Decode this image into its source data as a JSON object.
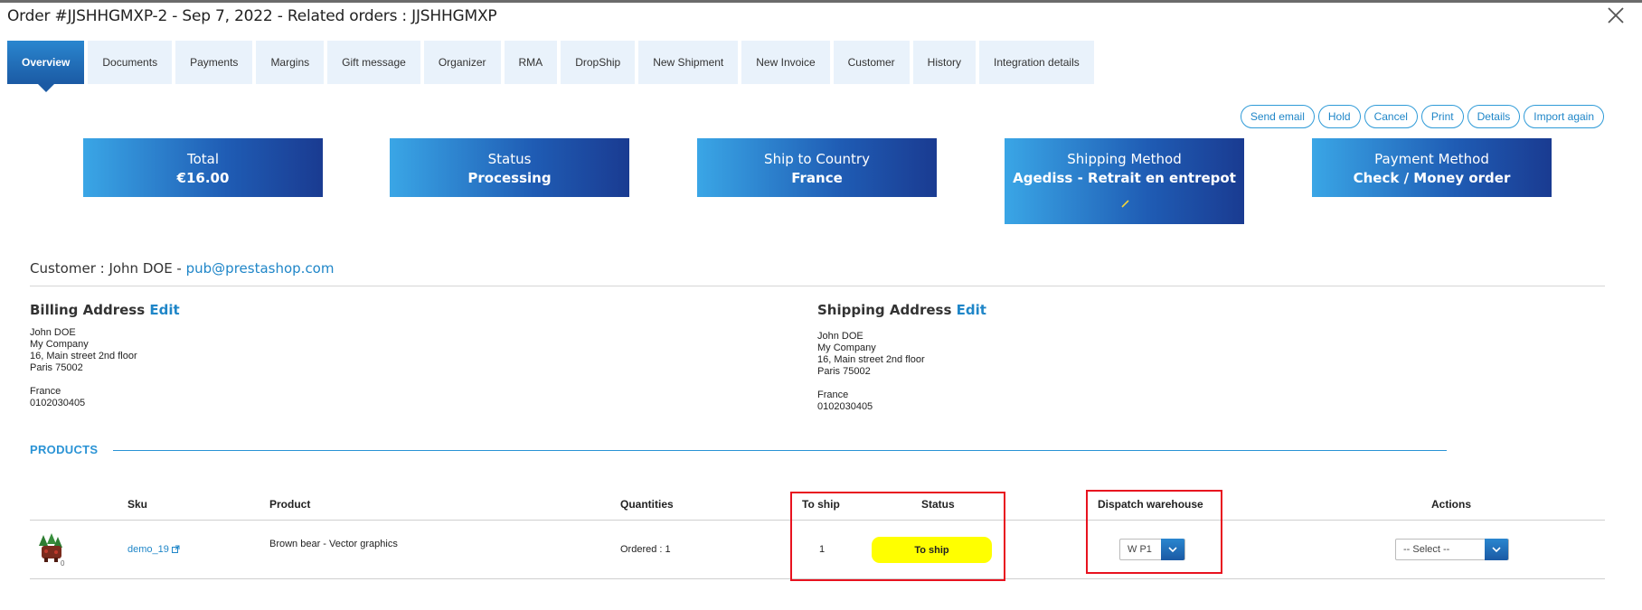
{
  "window": {
    "title": "Order #JJSHHGMXP-2 - Sep 7, 2022 - Related orders : JJSHHGMXP"
  },
  "tabs": [
    {
      "label": "Overview",
      "active": true
    },
    {
      "label": "Documents"
    },
    {
      "label": "Payments"
    },
    {
      "label": "Margins"
    },
    {
      "label": "Gift message"
    },
    {
      "label": "Organizer"
    },
    {
      "label": "RMA"
    },
    {
      "label": "DropShip"
    },
    {
      "label": "New Shipment"
    },
    {
      "label": "New Invoice"
    },
    {
      "label": "Customer"
    },
    {
      "label": "History"
    },
    {
      "label": "Integration details"
    }
  ],
  "actions": [
    "Send email",
    "Hold",
    "Cancel",
    "Print",
    "Details",
    "Import again"
  ],
  "kpis": [
    {
      "label": "Total",
      "value": "€16.00"
    },
    {
      "label": "Status",
      "value": "Processing"
    },
    {
      "label": "Ship to Country",
      "value": "France"
    },
    {
      "label": "Shipping Method",
      "value": "Agediss - Retrait en entrepot"
    },
    {
      "label": "Payment Method",
      "value": "Check / Money order"
    }
  ],
  "customer": {
    "prefix": "Customer : John DOE - ",
    "email": "pub@prestashop.com"
  },
  "billing": {
    "title": "Billing Address",
    "edit": "Edit",
    "lines": [
      "John DOE",
      "My Company",
      "16, Main street 2nd floor",
      "Paris 75002",
      "",
      "France",
      "0102030405"
    ]
  },
  "shipping": {
    "title": "Shipping Address",
    "edit": "Edit",
    "lines": [
      "John DOE",
      "My Company",
      "16, Main street 2nd floor",
      "Paris 75002",
      "",
      "France",
      "0102030405"
    ]
  },
  "products": {
    "title": "PRODUCTS",
    "headers": {
      "sku": "Sku",
      "product": "Product",
      "quantities": "Quantities",
      "to_ship": "To ship",
      "status": "Status",
      "warehouse": "Dispatch warehouse",
      "actions": "Actions"
    },
    "rows": [
      {
        "thumb_badge": "0",
        "sku": "demo_19",
        "product": "Brown bear - Vector graphics",
        "quantities": "Ordered : 1",
        "to_ship": "1",
        "status": "To ship",
        "warehouse": "W P1",
        "action": "-- Select --"
      }
    ]
  },
  "colors": {
    "accent": "#1f86c8",
    "highlight": "#e8121f",
    "status_badge": "#ffff00"
  }
}
